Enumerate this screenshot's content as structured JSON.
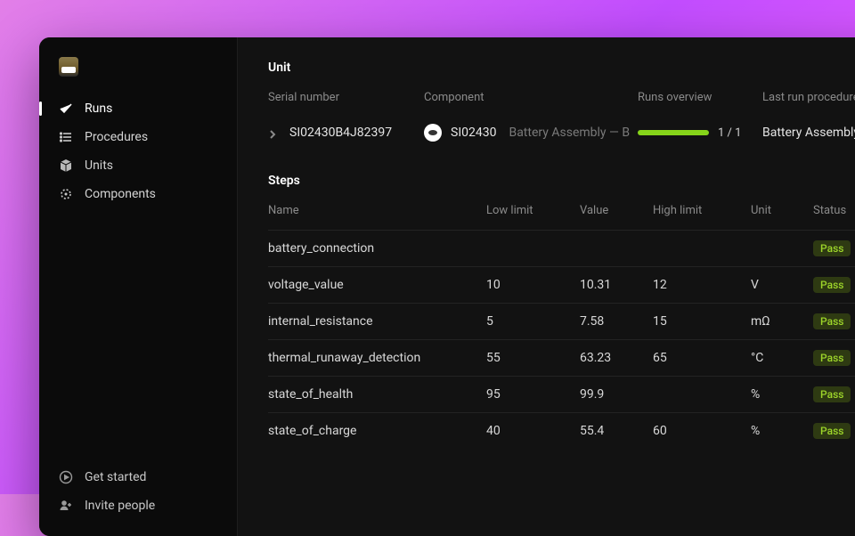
{
  "sidebar": {
    "nav": [
      {
        "label": "Runs",
        "icon": "check-icon",
        "active": true
      },
      {
        "label": "Procedures",
        "icon": "list-icon",
        "active": false
      },
      {
        "label": "Units",
        "icon": "cube-icon",
        "active": false
      },
      {
        "label": "Components",
        "icon": "target-icon",
        "active": false
      }
    ],
    "footer": [
      {
        "label": "Get started",
        "icon": "play-circle-icon"
      },
      {
        "label": "Invite people",
        "icon": "add-user-icon"
      }
    ]
  },
  "unit": {
    "title": "Unit",
    "headers": {
      "serial": "Serial number",
      "component": "Component",
      "runs": "Runs overview",
      "last": "Last run procedure"
    },
    "row": {
      "serial": "SI02430B4J82397",
      "component_code": "SI02430",
      "component_desc": "Battery Assembly — B",
      "runs_count": "1 / 1",
      "last_procedure": "Battery Assembly"
    }
  },
  "steps": {
    "title": "Steps",
    "headers": {
      "name": "Name",
      "low": "Low limit",
      "value": "Value",
      "high": "High limit",
      "unit": "Unit",
      "status": "Status"
    },
    "rows": [
      {
        "name": "battery_connection",
        "low": "",
        "value": "",
        "high": "",
        "unit": "",
        "status": "Pass"
      },
      {
        "name": "voltage_value",
        "low": "10",
        "value": "10.31",
        "high": "12",
        "unit": "V",
        "status": "Pass"
      },
      {
        "name": "internal_resistance",
        "low": "5",
        "value": "7.58",
        "high": "15",
        "unit": "mΩ",
        "status": "Pass"
      },
      {
        "name": "thermal_runaway_detection",
        "low": "55",
        "value": "63.23",
        "high": "65",
        "unit": "°C",
        "status": "Pass"
      },
      {
        "name": "state_of_health",
        "low": "95",
        "value": "99.9",
        "high": "",
        "unit": "%",
        "status": "Pass"
      },
      {
        "name": "state_of_charge",
        "low": "40",
        "value": "55.4",
        "high": "60",
        "unit": "%",
        "status": "Pass"
      }
    ]
  }
}
